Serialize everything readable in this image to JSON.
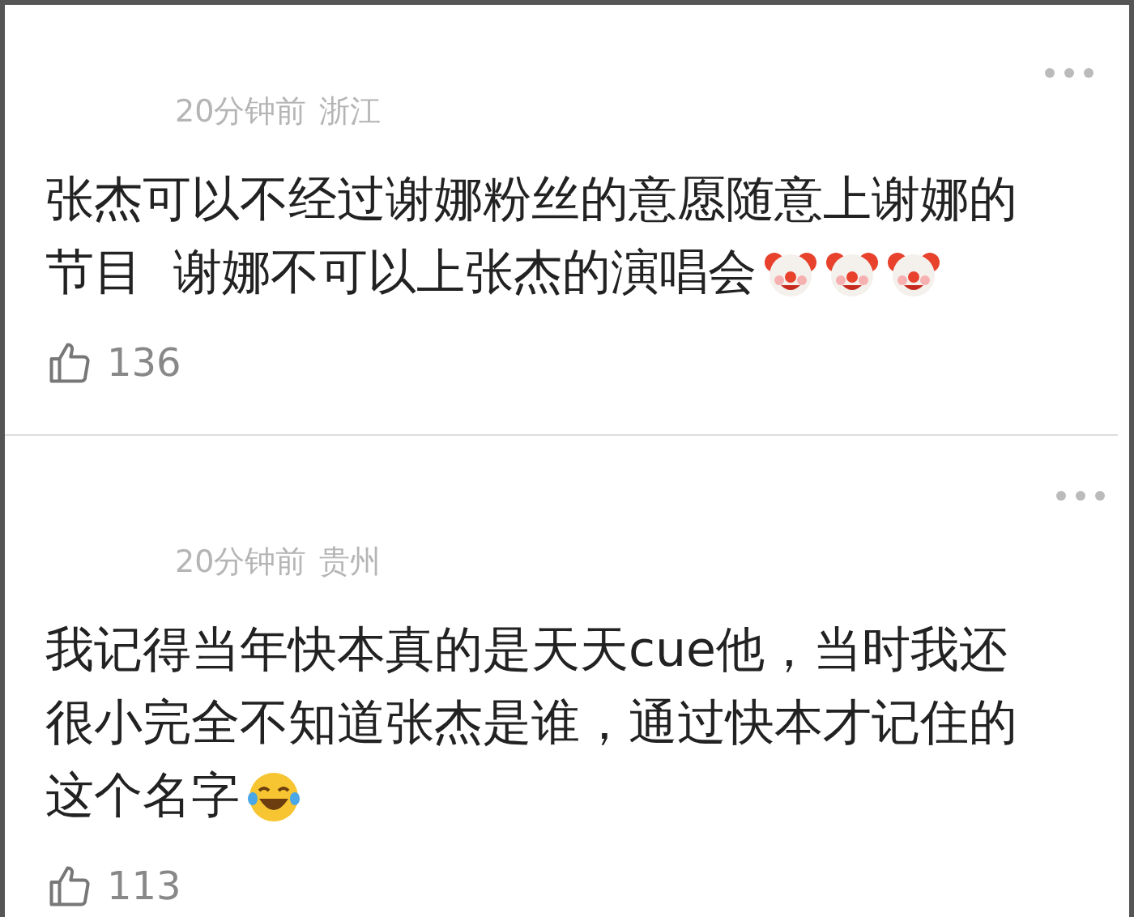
{
  "comments": [
    {
      "time": "20分钟前",
      "region": "浙江",
      "lines": [
        "张杰可以不经过谢娜粉丝的意愿随意上谢娜的",
        "节目  谢娜不可以上张杰的演唱会"
      ],
      "emojis": [
        {
          "kind": "clown"
        },
        {
          "kind": "clown"
        },
        {
          "kind": "clown"
        }
      ],
      "likes": "136"
    },
    {
      "time": "20分钟前",
      "region": "贵州",
      "lines": [
        "我记得当年快本真的是天天cue他，当时我还",
        "很小完全不知道张杰是谁，通过快本才记住的",
        "这个名字"
      ],
      "emojis": [
        {
          "kind": "laugh"
        }
      ],
      "likes": "113"
    }
  ]
}
